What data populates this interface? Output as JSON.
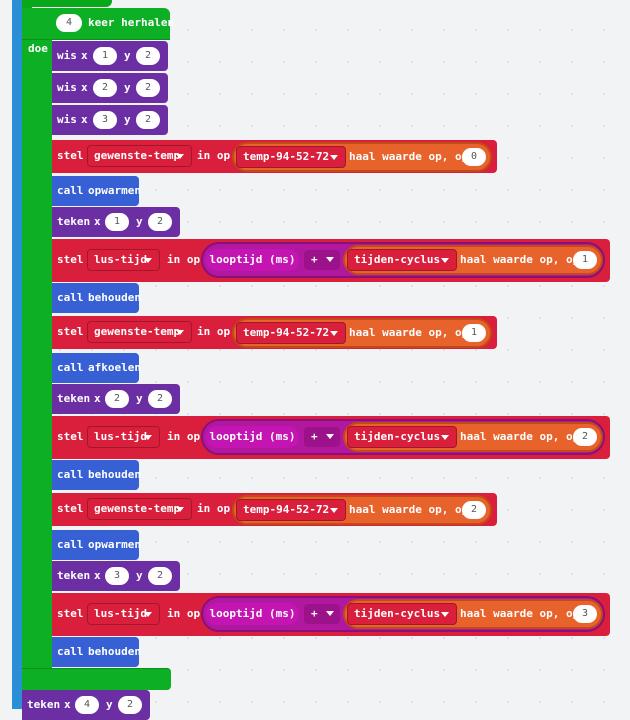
{
  "loop": {
    "count": "4",
    "label": "keer herhalen",
    "do_label": "doe"
  },
  "keywords": {
    "wis": "wis",
    "teken": "teken",
    "x": "x",
    "y": "y",
    "call": "call",
    "stel": "stel",
    "in_op": "in op"
  },
  "wis_blocks": [
    {
      "x": "1",
      "y": "2"
    },
    {
      "x": "2",
      "y": "2"
    },
    {
      "x": "3",
      "y": "2"
    }
  ],
  "rows": [
    {
      "type": "set_temp",
      "var": "gewenste-temp",
      "array": "temp-94-52-72",
      "get_label": "haal waarde op, op",
      "index": "0"
    },
    {
      "type": "call",
      "name": "opwarmen"
    },
    {
      "type": "teken",
      "x": "1",
      "y": "2"
    },
    {
      "type": "set_lus",
      "var": "lus-tijd",
      "looptime": "looptijd (ms)",
      "op": "+",
      "array": "tijden-cyclus",
      "get_label": "haal waarde op, op",
      "index": "1"
    },
    {
      "type": "call",
      "name": "behouden"
    },
    {
      "type": "set_temp",
      "var": "gewenste-temp",
      "array": "temp-94-52-72",
      "get_label": "haal waarde op, op",
      "index": "1"
    },
    {
      "type": "call",
      "name": "afkoelen"
    },
    {
      "type": "teken",
      "x": "2",
      "y": "2"
    },
    {
      "type": "set_lus",
      "var": "lus-tijd",
      "looptime": "looptijd (ms)",
      "op": "+",
      "array": "tijden-cyclus",
      "get_label": "haal waarde op, op",
      "index": "2"
    },
    {
      "type": "call",
      "name": "behouden"
    },
    {
      "type": "set_temp",
      "var": "gewenste-temp",
      "array": "temp-94-52-72",
      "get_label": "haal waarde op, op",
      "index": "2"
    },
    {
      "type": "call",
      "name": "opwarmen"
    },
    {
      "type": "teken",
      "x": "3",
      "y": "2"
    },
    {
      "type": "set_lus",
      "var": "lus-tijd",
      "looptime": "looptijd (ms)",
      "op": "+",
      "array": "tijden-cyclus",
      "get_label": "haal waarde op, op",
      "index": "3"
    },
    {
      "type": "call",
      "name": "behouden"
    }
  ],
  "after_loop": {
    "type": "teken",
    "x": "4",
    "y": "2"
  },
  "colors": {
    "loop": "#0db024",
    "led": "#6c2fa3",
    "call": "#3760d4",
    "variables": "#da1f3c",
    "arrays": "#e8622c",
    "math": "#b2179f"
  }
}
